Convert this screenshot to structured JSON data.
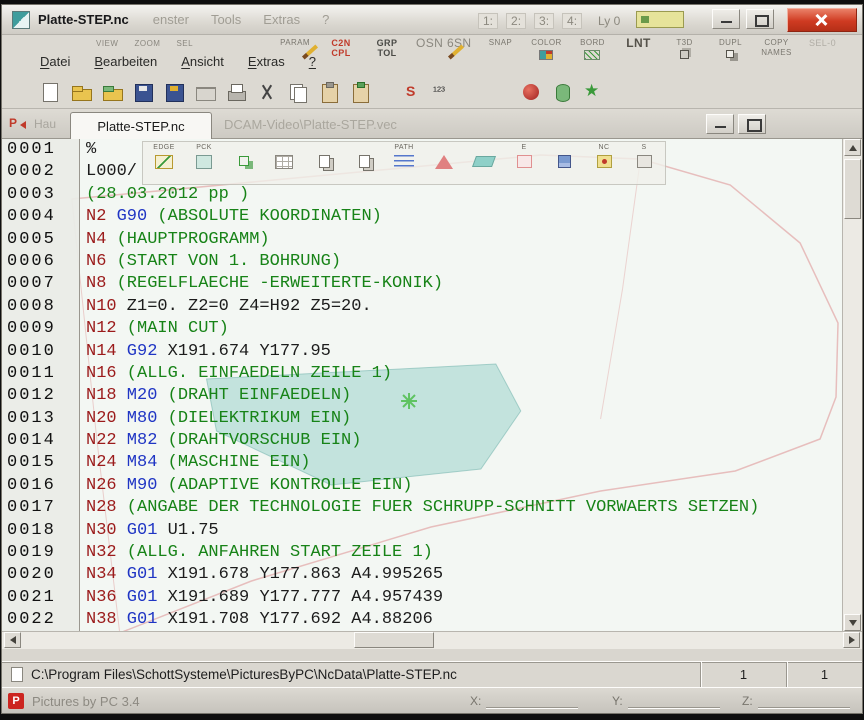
{
  "window": {
    "title": "Platte-STEP.nc",
    "background_menu_items": [
      "enster",
      "Tools",
      "Extras",
      "?"
    ],
    "view_buttons": [
      "1:",
      "2:",
      "3:",
      "4:"
    ],
    "layer_label": "Ly 0",
    "left_group_labels": [
      "VIEW",
      "ZOOM",
      "SEL"
    ]
  },
  "menubar": {
    "items": [
      "Datei",
      "Bearbeiten",
      "Ansicht",
      "Extras",
      "?"
    ]
  },
  "tool_groups": [
    {
      "lines": [
        "PARAM"
      ],
      "cls": "tiny"
    },
    {
      "lines": [
        "C2N",
        "CPL"
      ],
      "cls": "red"
    },
    {
      "lines": [
        "GRP",
        "TOL"
      ],
      "cls": "dark"
    },
    {
      "lines": [
        "OSN 6SN"
      ],
      "cls": "big"
    },
    {
      "lines": [
        "SNAP"
      ],
      "cls": "tiny"
    },
    {
      "lines": [
        "COLOR"
      ],
      "cls": "tiny",
      "icon": "palette-grid"
    },
    {
      "lines": [
        "BORD"
      ],
      "cls": "tiny",
      "icon": "hatch"
    },
    {
      "lines": [
        "LNT"
      ],
      "cls": "big dark"
    },
    {
      "lines": [
        "T3D"
      ],
      "cls": "tiny",
      "icon": "cube-small"
    },
    {
      "lines": [
        "DUPL"
      ],
      "cls": "tiny",
      "icon": "dup-squares"
    },
    {
      "lines": [
        "COPY",
        "NAMES"
      ],
      "cls": "tiny"
    },
    {
      "lines": [
        "SEL-0"
      ],
      "cls": "ghost"
    }
  ],
  "toolbar_icons": [
    "new-doc",
    "folder-open",
    "folder-add",
    "floppy",
    "floppy-pen",
    "drawer",
    "printer",
    "scissors",
    "pages",
    "clipboard",
    "clipboard-check",
    "stamp-s",
    "superscript-123",
    "palette",
    "cylinder",
    "star"
  ],
  "doc_tabs": {
    "window_marker": "P",
    "left_ghost": "Hau",
    "active_tab": "Platte-STEP.nc",
    "ghost_path": "DCAM-Video\\Platte-STEP.vec"
  },
  "editor": {
    "mini_toolbar": [
      {
        "label": "EDGE",
        "icon": "edge"
      },
      {
        "label": "PCK",
        "icon": "pck"
      },
      {
        "label": "",
        "icon": "gsq"
      },
      {
        "label": "",
        "icon": "grid"
      },
      {
        "label": "",
        "icon": "pages"
      },
      {
        "label": "",
        "icon": "pages"
      },
      {
        "label": "PATH",
        "icon": "waves"
      },
      {
        "label": "",
        "icon": "redtri"
      },
      {
        "label": "",
        "icon": "teal"
      },
      {
        "label": "E",
        "icon": "pinkE"
      },
      {
        "label": "",
        "icon": "cube"
      },
      {
        "label": "NC",
        "icon": "ncbox"
      },
      {
        "label": "S",
        "icon": "sbox"
      }
    ],
    "lines": [
      {
        "num": "0001",
        "segs": [
          {
            "k": "p",
            "t": "%"
          }
        ]
      },
      {
        "num": "0002",
        "segs": [
          {
            "k": "p",
            "t": "L000/"
          }
        ]
      },
      {
        "num": "0003",
        "segs": [
          {
            "k": "c",
            "t": "(28.03.2012 pp )"
          }
        ]
      },
      {
        "num": "0004",
        "segs": [
          {
            "k": "n",
            "t": "N2"
          },
          {
            "k": "g",
            "t": "G90"
          },
          {
            "k": "c",
            "t": "(ABSOLUTE KOORDINATEN)"
          }
        ]
      },
      {
        "num": "0005",
        "segs": [
          {
            "k": "n",
            "t": "N4"
          },
          {
            "k": "c",
            "t": "(HAUPTPROGRAMM)"
          }
        ]
      },
      {
        "num": "0006",
        "segs": [
          {
            "k": "n",
            "t": "N6"
          },
          {
            "k": "c",
            "t": "(START VON 1. BOHRUNG)"
          }
        ]
      },
      {
        "num": "0007",
        "segs": [
          {
            "k": "n",
            "t": "N8"
          },
          {
            "k": "c",
            "t": "(REGELFLAECHE -ERWEITERTE-KONIK)"
          }
        ]
      },
      {
        "num": "0008",
        "segs": [
          {
            "k": "n",
            "t": "N10"
          },
          {
            "k": "p",
            "t": "Z1=0. Z2=0 Z4=H92 Z5=20."
          }
        ]
      },
      {
        "num": "0009",
        "segs": [
          {
            "k": "n",
            "t": "N12"
          },
          {
            "k": "c",
            "t": "(MAIN CUT)"
          }
        ]
      },
      {
        "num": "0010",
        "segs": [
          {
            "k": "n",
            "t": "N14"
          },
          {
            "k": "g",
            "t": "G92"
          },
          {
            "k": "p",
            "t": "X191.674 Y177.95"
          }
        ]
      },
      {
        "num": "0011",
        "segs": [
          {
            "k": "n",
            "t": "N16"
          },
          {
            "k": "c",
            "t": "(ALLG. EINFAEDELN ZEILE 1)"
          }
        ]
      },
      {
        "num": "0012",
        "segs": [
          {
            "k": "n",
            "t": "N18"
          },
          {
            "k": "g",
            "t": "M20"
          },
          {
            "k": "c",
            "t": "(DRAHT EINFAEDELN)"
          }
        ]
      },
      {
        "num": "0013",
        "segs": [
          {
            "k": "n",
            "t": "N20"
          },
          {
            "k": "g",
            "t": "M80"
          },
          {
            "k": "c",
            "t": "(DIELEKTRIKUM EIN)"
          }
        ]
      },
      {
        "num": "0014",
        "segs": [
          {
            "k": "n",
            "t": "N22"
          },
          {
            "k": "g",
            "t": "M82"
          },
          {
            "k": "c",
            "t": "(DRAHTVORSCHUB EIN)"
          }
        ]
      },
      {
        "num": "0015",
        "segs": [
          {
            "k": "n",
            "t": "N24"
          },
          {
            "k": "g",
            "t": "M84"
          },
          {
            "k": "c",
            "t": "(MASCHINE EIN)"
          }
        ]
      },
      {
        "num": "0016",
        "segs": [
          {
            "k": "n",
            "t": "N26"
          },
          {
            "k": "g",
            "t": "M90"
          },
          {
            "k": "c",
            "t": "(ADAPTIVE KONTROLLE EIN)"
          }
        ]
      },
      {
        "num": "0017",
        "segs": [
          {
            "k": "n",
            "t": "N28"
          },
          {
            "k": "c",
            "t": "(ANGABE DER TECHNOLOGIE FUER SCHRUPP-SCHNITT VORWAERTS SETZEN)"
          }
        ]
      },
      {
        "num": "0018",
        "segs": [
          {
            "k": "n",
            "t": "N30"
          },
          {
            "k": "g",
            "t": "G01"
          },
          {
            "k": "p",
            "t": "U1.75"
          }
        ]
      },
      {
        "num": "0019",
        "segs": [
          {
            "k": "n",
            "t": "N32"
          },
          {
            "k": "c",
            "t": "(ALLG. ANFAHREN START ZEILE 1)"
          }
        ]
      },
      {
        "num": "0020",
        "segs": [
          {
            "k": "n",
            "t": "N34"
          },
          {
            "k": "g",
            "t": "G01"
          },
          {
            "k": "p",
            "t": "X191.678 Y177.863 A4.995265"
          }
        ]
      },
      {
        "num": "0021",
        "segs": [
          {
            "k": "n",
            "t": "N36"
          },
          {
            "k": "g",
            "t": "G01"
          },
          {
            "k": "p",
            "t": "X191.689 Y177.777 A4.957439"
          }
        ]
      },
      {
        "num": "0022",
        "segs": [
          {
            "k": "n",
            "t": "N38"
          },
          {
            "k": "g",
            "t": "G01"
          },
          {
            "k": "p",
            "t": "X191.708 Y177.692 A4.88206"
          }
        ]
      }
    ]
  },
  "statusbar": {
    "path": "C:\\Program Files\\SchottSysteme\\PicturesByPC\\NcData\\Platte-STEP.nc",
    "value1": "1",
    "value2": "1"
  },
  "bottombar": {
    "logo_letter": "P",
    "app_name": "Pictures by PC 3.4",
    "coord_labels": [
      "X:",
      "Y:",
      "Z:"
    ]
  },
  "colors": {
    "close_button": "#cf3b22",
    "code_address": "#9b1b1b",
    "code_function": "#1f35c4",
    "code_comment": "#178317",
    "cad_outline": "#dd8f8f",
    "cad_surface": "#93cfc7",
    "marker_green": "#55c055"
  }
}
